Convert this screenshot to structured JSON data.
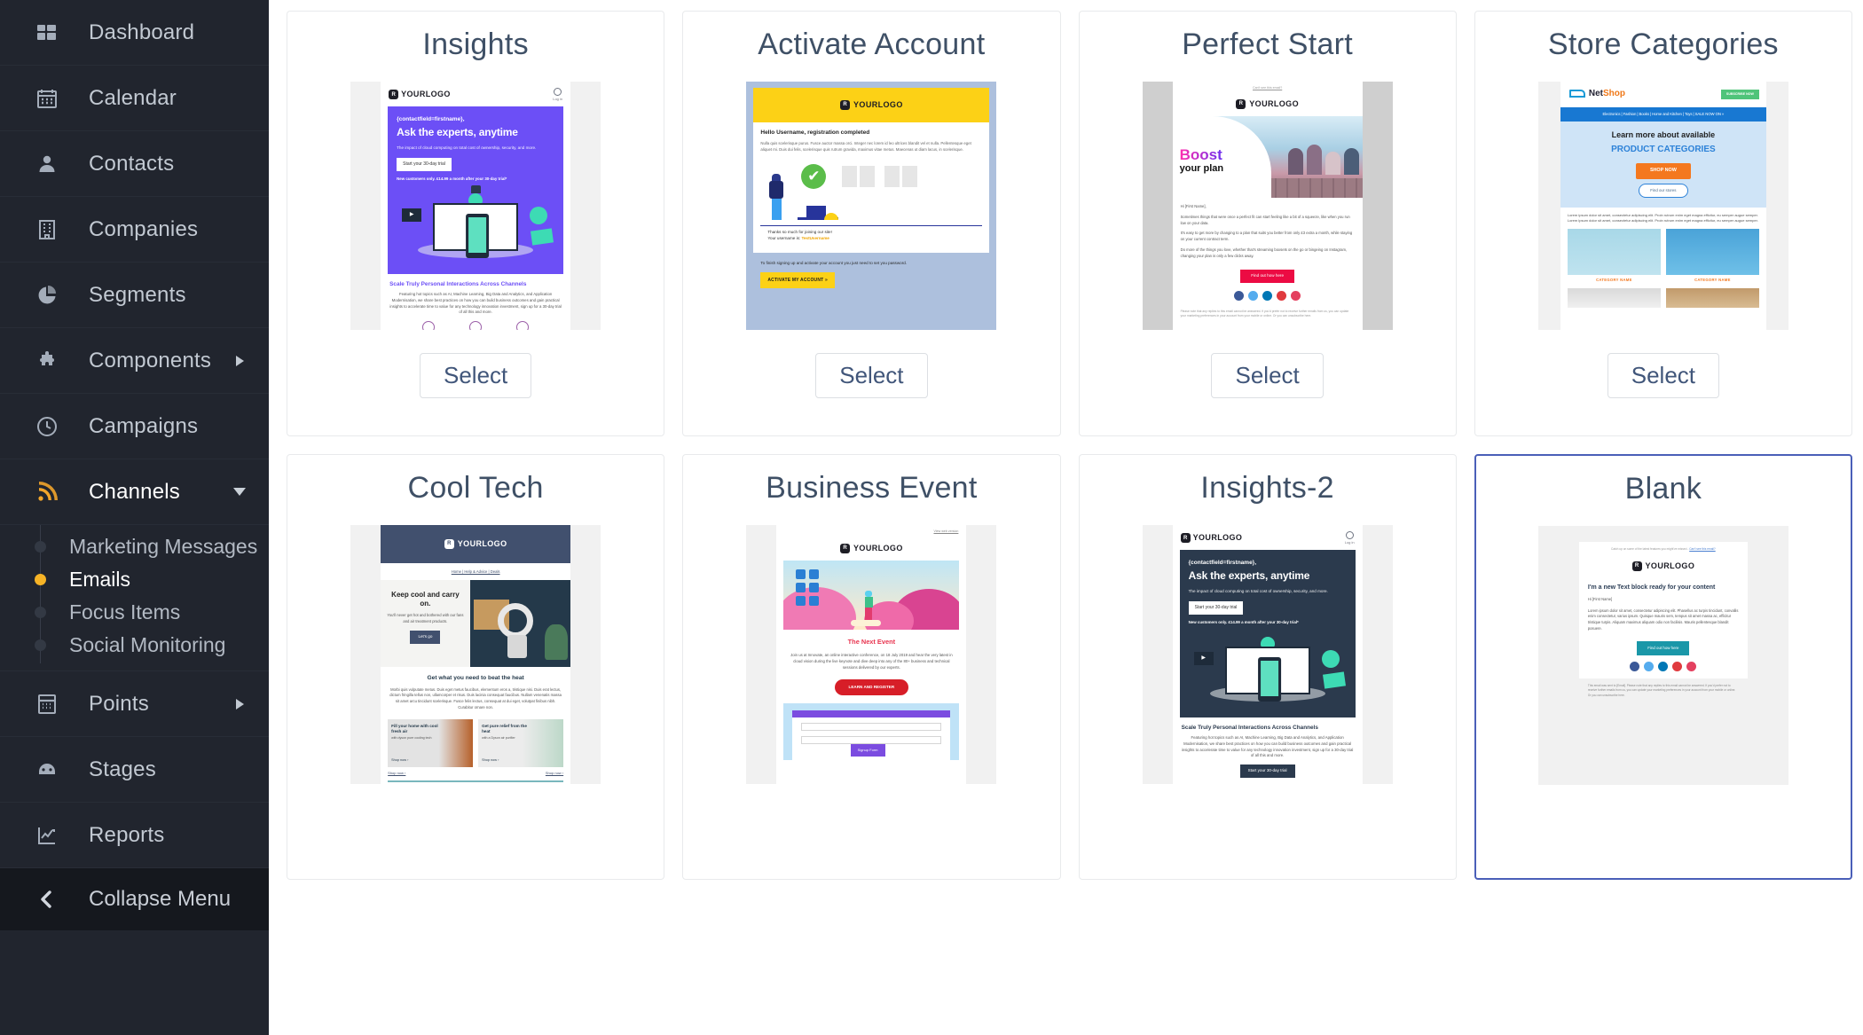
{
  "sidebar": {
    "items": [
      {
        "label": "Dashboard",
        "icon": "grid-icon",
        "expandable": false
      },
      {
        "label": "Calendar",
        "icon": "calendar-icon",
        "expandable": false
      },
      {
        "label": "Contacts",
        "icon": "person-icon",
        "expandable": false
      },
      {
        "label": "Companies",
        "icon": "building-icon",
        "expandable": false
      },
      {
        "label": "Segments",
        "icon": "pie-chart-icon",
        "expandable": false
      },
      {
        "label": "Components",
        "icon": "puzzle-icon",
        "expandable": true
      },
      {
        "label": "Campaigns",
        "icon": "clock-icon",
        "expandable": false
      },
      {
        "label": "Channels",
        "icon": "rss-icon",
        "expandable": true,
        "open": true
      }
    ],
    "channels_submenu": [
      {
        "label": "Marketing Messages",
        "active": false
      },
      {
        "label": "Emails",
        "active": true
      },
      {
        "label": "Focus Items",
        "active": false
      },
      {
        "label": "Social Monitoring",
        "active": false
      }
    ],
    "items_after": [
      {
        "label": "Points",
        "icon": "calculator-icon",
        "expandable": true
      },
      {
        "label": "Stages",
        "icon": "gauge-icon",
        "expandable": false
      },
      {
        "label": "Reports",
        "icon": "chart-line-icon",
        "expandable": false
      }
    ],
    "collapse": {
      "label": "Collapse Menu",
      "icon": "chevron-left-icon"
    },
    "colors": {
      "background": "#21252e",
      "active_dot": "#f6b326",
      "collapse_bg": "#15181e"
    }
  },
  "main": {
    "select_label": "Select",
    "selected_card": "Blank",
    "selected_border_color": "#4a5fb8",
    "cards": [
      {
        "title": "Insights"
      },
      {
        "title": "Activate Account"
      },
      {
        "title": "Perfect Start"
      },
      {
        "title": "Store Categories"
      },
      {
        "title": "Cool Tech"
      },
      {
        "title": "Business Event"
      },
      {
        "title": "Insights-2"
      },
      {
        "title": "Blank"
      }
    ]
  },
  "thumbnails": {
    "insights": {
      "logo": "YOURLOGO",
      "login": "Log in",
      "greeting": "{contactfield=firstname},",
      "headline": "Ask the experts, anytime",
      "subtext": "The impact of cloud computing on total cost of ownership, security, and more.",
      "cta": "Start your 30-day trial",
      "note": "New customers only. £14.99 a month after your 30-day trial*",
      "foot_heading": "Scale Truly Personal Interactions Across Channels",
      "foot_text": "Featuring hot topics such as AI, Machine Learning, Big Data and Analytics, and Application Modernisation, we share best practices on how you can build business outcomes and gain practical insights to accelerate time to value for any technology innovation investment, sign up for a 30-day trial of all this and more.",
      "hero_color": "#6c4ff6"
    },
    "insights2": {
      "logo": "YOURLOGO",
      "login": "Log in",
      "greeting": "{contactfield=firstname},",
      "headline": "Ask the experts, anytime",
      "subtext": "The impact of cloud computing on total cost of ownership, security, and more.",
      "cta": "Start your 30-day trial",
      "note": "New customers only. £14.99 a month after your 30-day trial*",
      "foot_heading": "Scale Truly Personal Interactions Across Channels",
      "foot_text": "Featuring hot topics such as AI, Machine Learning, Big Data and Analytics, and Application Modernisation, we share best practices on how you can build business outcomes and gain practical insights to accelerate time to value for any technology innovation investment, sign up for a 30-day trial of all this and more.",
      "foot_button": "Start your 30-day trial",
      "hero_color": "#2b3a4d"
    },
    "activate_account": {
      "logo": "YOURLOGO",
      "heading": "Hello Username, registration completed",
      "body": "Nulla quis scelerisque purus. Fusce auctor massa orci. Integer nec lorem id leo ultrices blandit vel et nulla. Pellentesque eget aliquet mi. Duis dui felis, scelerisque quis rutrum gravida, maximus vitae metus. Maecenas ut diam lacus, in scelerisque.",
      "thanks": "Thanks so much for joining our site!",
      "username_line": "Your username is:",
      "username_value": "TestUsername",
      "footer_text": "To finish signing up and activate your account you just need to set you password.",
      "button": "ACTIVATE MY ACCOUNT »",
      "accent": "#fcd116",
      "frame": "#adc0dd"
    },
    "perfect_start": {
      "preheader": "Can't see this email?",
      "logo": "YOURLOGO",
      "hero_word_1": "Boost",
      "hero_word_2": "your plan",
      "salutation": "Hi [First Name],",
      "p1": "Sometimes things that were once a perfect fit can start feeling like a bit of a squeeze, like when you run low on your data.",
      "p2": "It's easy to get more by changing to a plan that suits you better from only £3 extra a month, while staying on your current contract term.",
      "p3": "Do more of the things you love, whether that's streaming boxsets on the go or bingeing on Instagram, changing your plan is only a few clicks away.",
      "button": "Find out how here",
      "fine_print": "Please note that any replies to this email cannot be answered. If you'd prefer not to receive further emails from us, you can update your marketing preferences in your account from your mobile or online. Or you can unsubscribe here.",
      "button_color": "#ec0b43"
    },
    "store_categories": {
      "brand": "NetShop",
      "subscribe": "SUBSCRIBE NOW",
      "nav": "Electronics | Fashion | Books | Home and Kitchen | Toys | SALE NOW ON »",
      "heading_1": "Learn more about available",
      "heading_2": "PRODUCT CATEGORIES",
      "shop_button": "SHOP NOW",
      "find_button": "Find our stores",
      "body": "Lorem ipsum dolor sit amet, consectetur adipiscing elit. Proin rutrum enim eget magna efficitur, eu semper augue semper. Lorem ipsum dolor sit amet, consectetur adipiscing elit. Proin rutrum enim eget magna efficitur, eu semper augue semper.",
      "category_label": "CATEGORY NAME",
      "accent": "#f4781f"
    },
    "cool_tech": {
      "logo": "YOURLOGO",
      "links": "Home | Help & Advice | Deals",
      "heading": "Keep cool and carry on.",
      "subtext": "You'll never get hot and bothered with our fans and air treatment products.",
      "button": "Let's go",
      "mid_heading": "Get what you need to beat the heat",
      "mid_text": "Morbi quis vulputate metus. Duis eget metus faucibus, elementum eros a, tristique nisi. Duis erat lectus, dictum fringilla tellus non, ullamcorper et risus. Duis lacinia consequat faucibus. Nullam venenatis massa sit amet arcu tincidunt scelerisque. Fusce felis lectus, consequat at dui eget, volutpat finibus nibh. Curabitur ornare non.",
      "tile1_title": "Fill your home with cool fresh air",
      "tile1_sub": "with dyson pure cooling tech",
      "tile1_cta": "Shop now ›",
      "tile2_title": "Get pure relief from the heat",
      "tile2_sub": "with a Dyson air purifier",
      "tile2_cta": "Shop now ›",
      "more_left": "Shop now ›",
      "more_right": "Shop now ›",
      "header_color": "#41506e"
    },
    "business_event": {
      "preheader": "View web version",
      "logo": "YOURLOGO",
      "heading": "The Next Event",
      "body": "Join us at Innovate, an online interactive conference, on 18 July 2019 and hear the very latest in cloud vision during the live keynote and dive deep into any of the 80+ business and technical sessions delivered by our experts.",
      "button": "LEARN AND REGISTER",
      "form_label": "Signup Form",
      "accent": "#d71e28"
    },
    "blank": {
      "preheader": "Catch up on some of the latest features you might've missed -",
      "preheader_link": "Can't see this email?",
      "logo": "YOURLOGO",
      "heading": "I'm a new Text block ready for your content",
      "salutation": "Hi [First Name]",
      "body": "Lorem ipsum dolor sit amet, consectetur adipiscing elit. Phasellus ac turpis tincidunt, convallis enim consectetur, varius ipsum. Quisque mauris sem, tempus sit amet massa ac, efficitur tristique turpis. Aliquam maximus aliquam odio non facilisis. Mauris pellentesque blandit posuere.",
      "button": "Find out how here",
      "footer": "This email was sent to [Email]. Please note that any replies to this email cannot be answered. If you'd prefer not to receive further emails from us, you can update your marketing preferences in your account from your mobile or online. Or you can unsubscribe here.",
      "button_color": "#1a97a8"
    }
  }
}
